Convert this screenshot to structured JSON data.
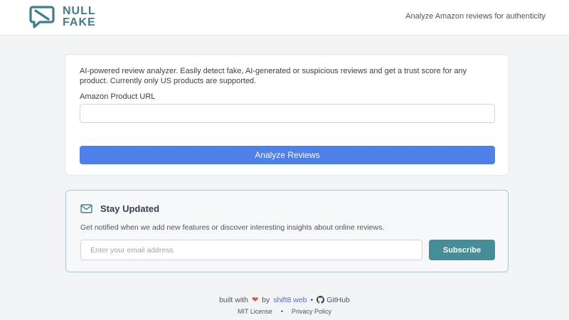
{
  "header": {
    "logo_line1": "NULL",
    "logo_line2": "FAKE",
    "logo_icon": "speech-bubble-slash-icon",
    "tagline": "Analyze Amazon reviews for authenticity"
  },
  "analyzer": {
    "intro": "AI-powered review analyzer. Easily detect fake, AI-generated or suspicious reviews and get a trust score for any product. Currently only US products are supported.",
    "url_label": "Amazon Product URL",
    "url_value": "",
    "button_label": "Analyze Reviews"
  },
  "newsletter": {
    "icon": "mail-icon",
    "title": "Stay Updated",
    "description": "Get notified when we add new features or discover interesting insights about online reviews.",
    "email_placeholder": "Enter your email address",
    "email_value": "",
    "button_label": "Subscribe"
  },
  "footer": {
    "built_with": "built with",
    "heart_icon": "heart-icon",
    "by": "by",
    "author": "shift8 web",
    "sep1": "•",
    "github_icon": "github-icon",
    "github": "GitHub",
    "license": "MIT License",
    "sep2": "•",
    "privacy": "Privacy Policy"
  },
  "colors": {
    "brand": "#3f7d8c",
    "analyze_button": "#4f7fe8",
    "subscribe_button": "#458e99",
    "link": "#5b6bd4",
    "heart": "#e05252"
  }
}
